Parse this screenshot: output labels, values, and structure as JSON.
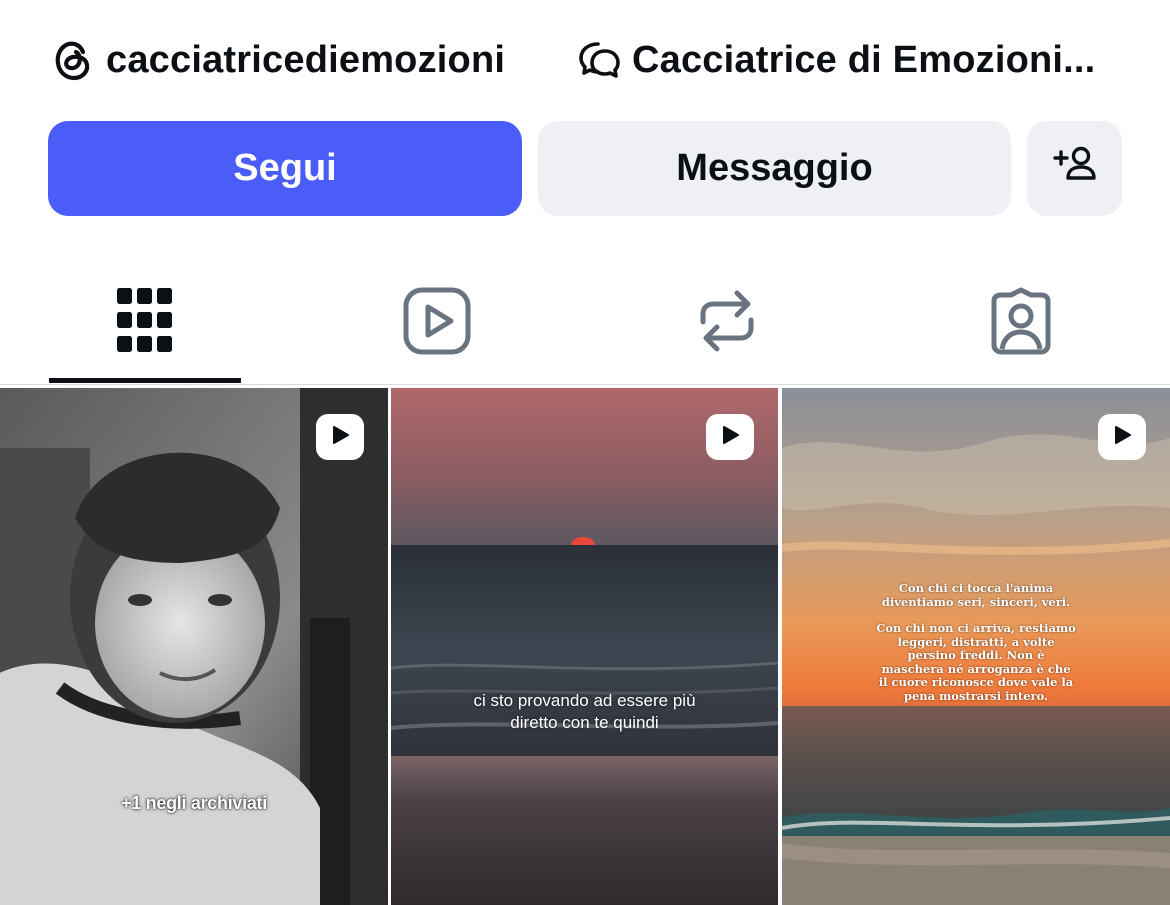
{
  "header": {
    "threads_handle": "cacciatricediemozioni",
    "threads_icon": "threads-icon",
    "channel_name": "Cacciatrice di Emozioni...",
    "channel_icon": "broadcast-channel-icon"
  },
  "actions": {
    "follow_label": "Segui",
    "message_label": "Messaggio",
    "add_user_icon": "add-user-icon",
    "follow_color": "#4a5df9",
    "secondary_color": "#eef0f4"
  },
  "tabs": [
    {
      "name": "posts-grid",
      "icon": "grid-icon",
      "selected": true
    },
    {
      "name": "reels",
      "icon": "reels-icon",
      "selected": false
    },
    {
      "name": "reposts",
      "icon": "repost-icon",
      "selected": false
    },
    {
      "name": "tagged",
      "icon": "tagged-person-icon",
      "selected": false
    }
  ],
  "posts": [
    {
      "type": "reel",
      "badge_icon": "play-icon",
      "caption": "+1 negli archiviati"
    },
    {
      "type": "reel",
      "badge_icon": "play-icon",
      "caption_lines": [
        "ci sto provando ad essere più",
        "diretto con te quindi"
      ]
    },
    {
      "type": "reel",
      "badge_icon": "play-icon",
      "caption_lines": [
        "Con chi ci tocca l'anima",
        "diventiamo seri, sinceri, veri.",
        "",
        "Con chi non ci arriva, restiamo",
        "leggeri, distratti, a volte",
        "persino freddi. Non è",
        "maschera né arroganza è che",
        "il cuore riconosce dove vale la",
        "pena mostrarsi intero."
      ]
    }
  ]
}
